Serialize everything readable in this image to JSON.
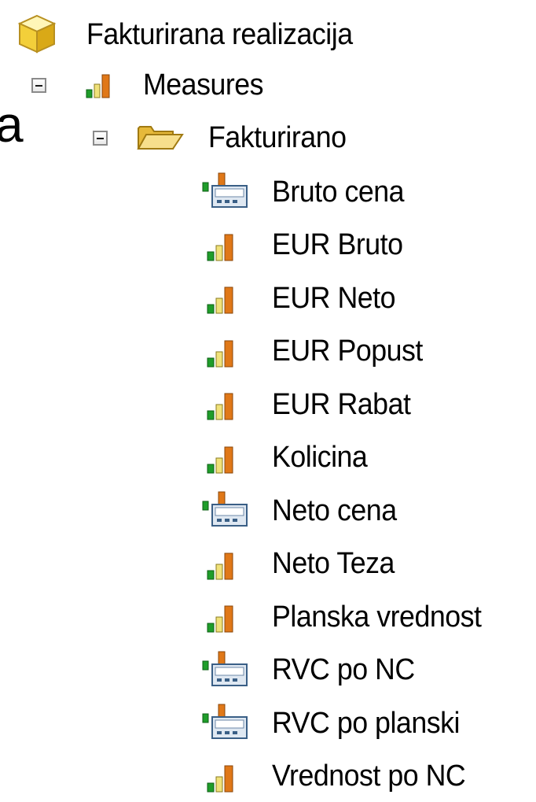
{
  "fragment_text": "a",
  "cube": {
    "label": "Fakturirana realizacija",
    "icon": "cube-icon"
  },
  "measures": {
    "label": "Measures",
    "icon": "measures-icon",
    "expanded": true
  },
  "folder": {
    "label": "Fakturirano",
    "icon": "open-folder-icon",
    "expanded": true
  },
  "items": [
    {
      "label": "Bruto cena",
      "icon": "calculated-measure-icon"
    },
    {
      "label": "EUR Bruto",
      "icon": "measure-icon"
    },
    {
      "label": "EUR Neto",
      "icon": "measure-icon"
    },
    {
      "label": "EUR Popust",
      "icon": "measure-icon"
    },
    {
      "label": "EUR Rabat",
      "icon": "measure-icon"
    },
    {
      "label": "Kolicina",
      "icon": "measure-icon"
    },
    {
      "label": "Neto cena",
      "icon": "calculated-measure-icon"
    },
    {
      "label": "Neto Teza",
      "icon": "measure-icon"
    },
    {
      "label": "Planska vrednost",
      "icon": "measure-icon"
    },
    {
      "label": "RVC po NC",
      "icon": "calculated-measure-icon"
    },
    {
      "label": "RVC po planski",
      "icon": "calculated-measure-icon"
    },
    {
      "label": "Vrednost po NC",
      "icon": "measure-icon"
    }
  ]
}
